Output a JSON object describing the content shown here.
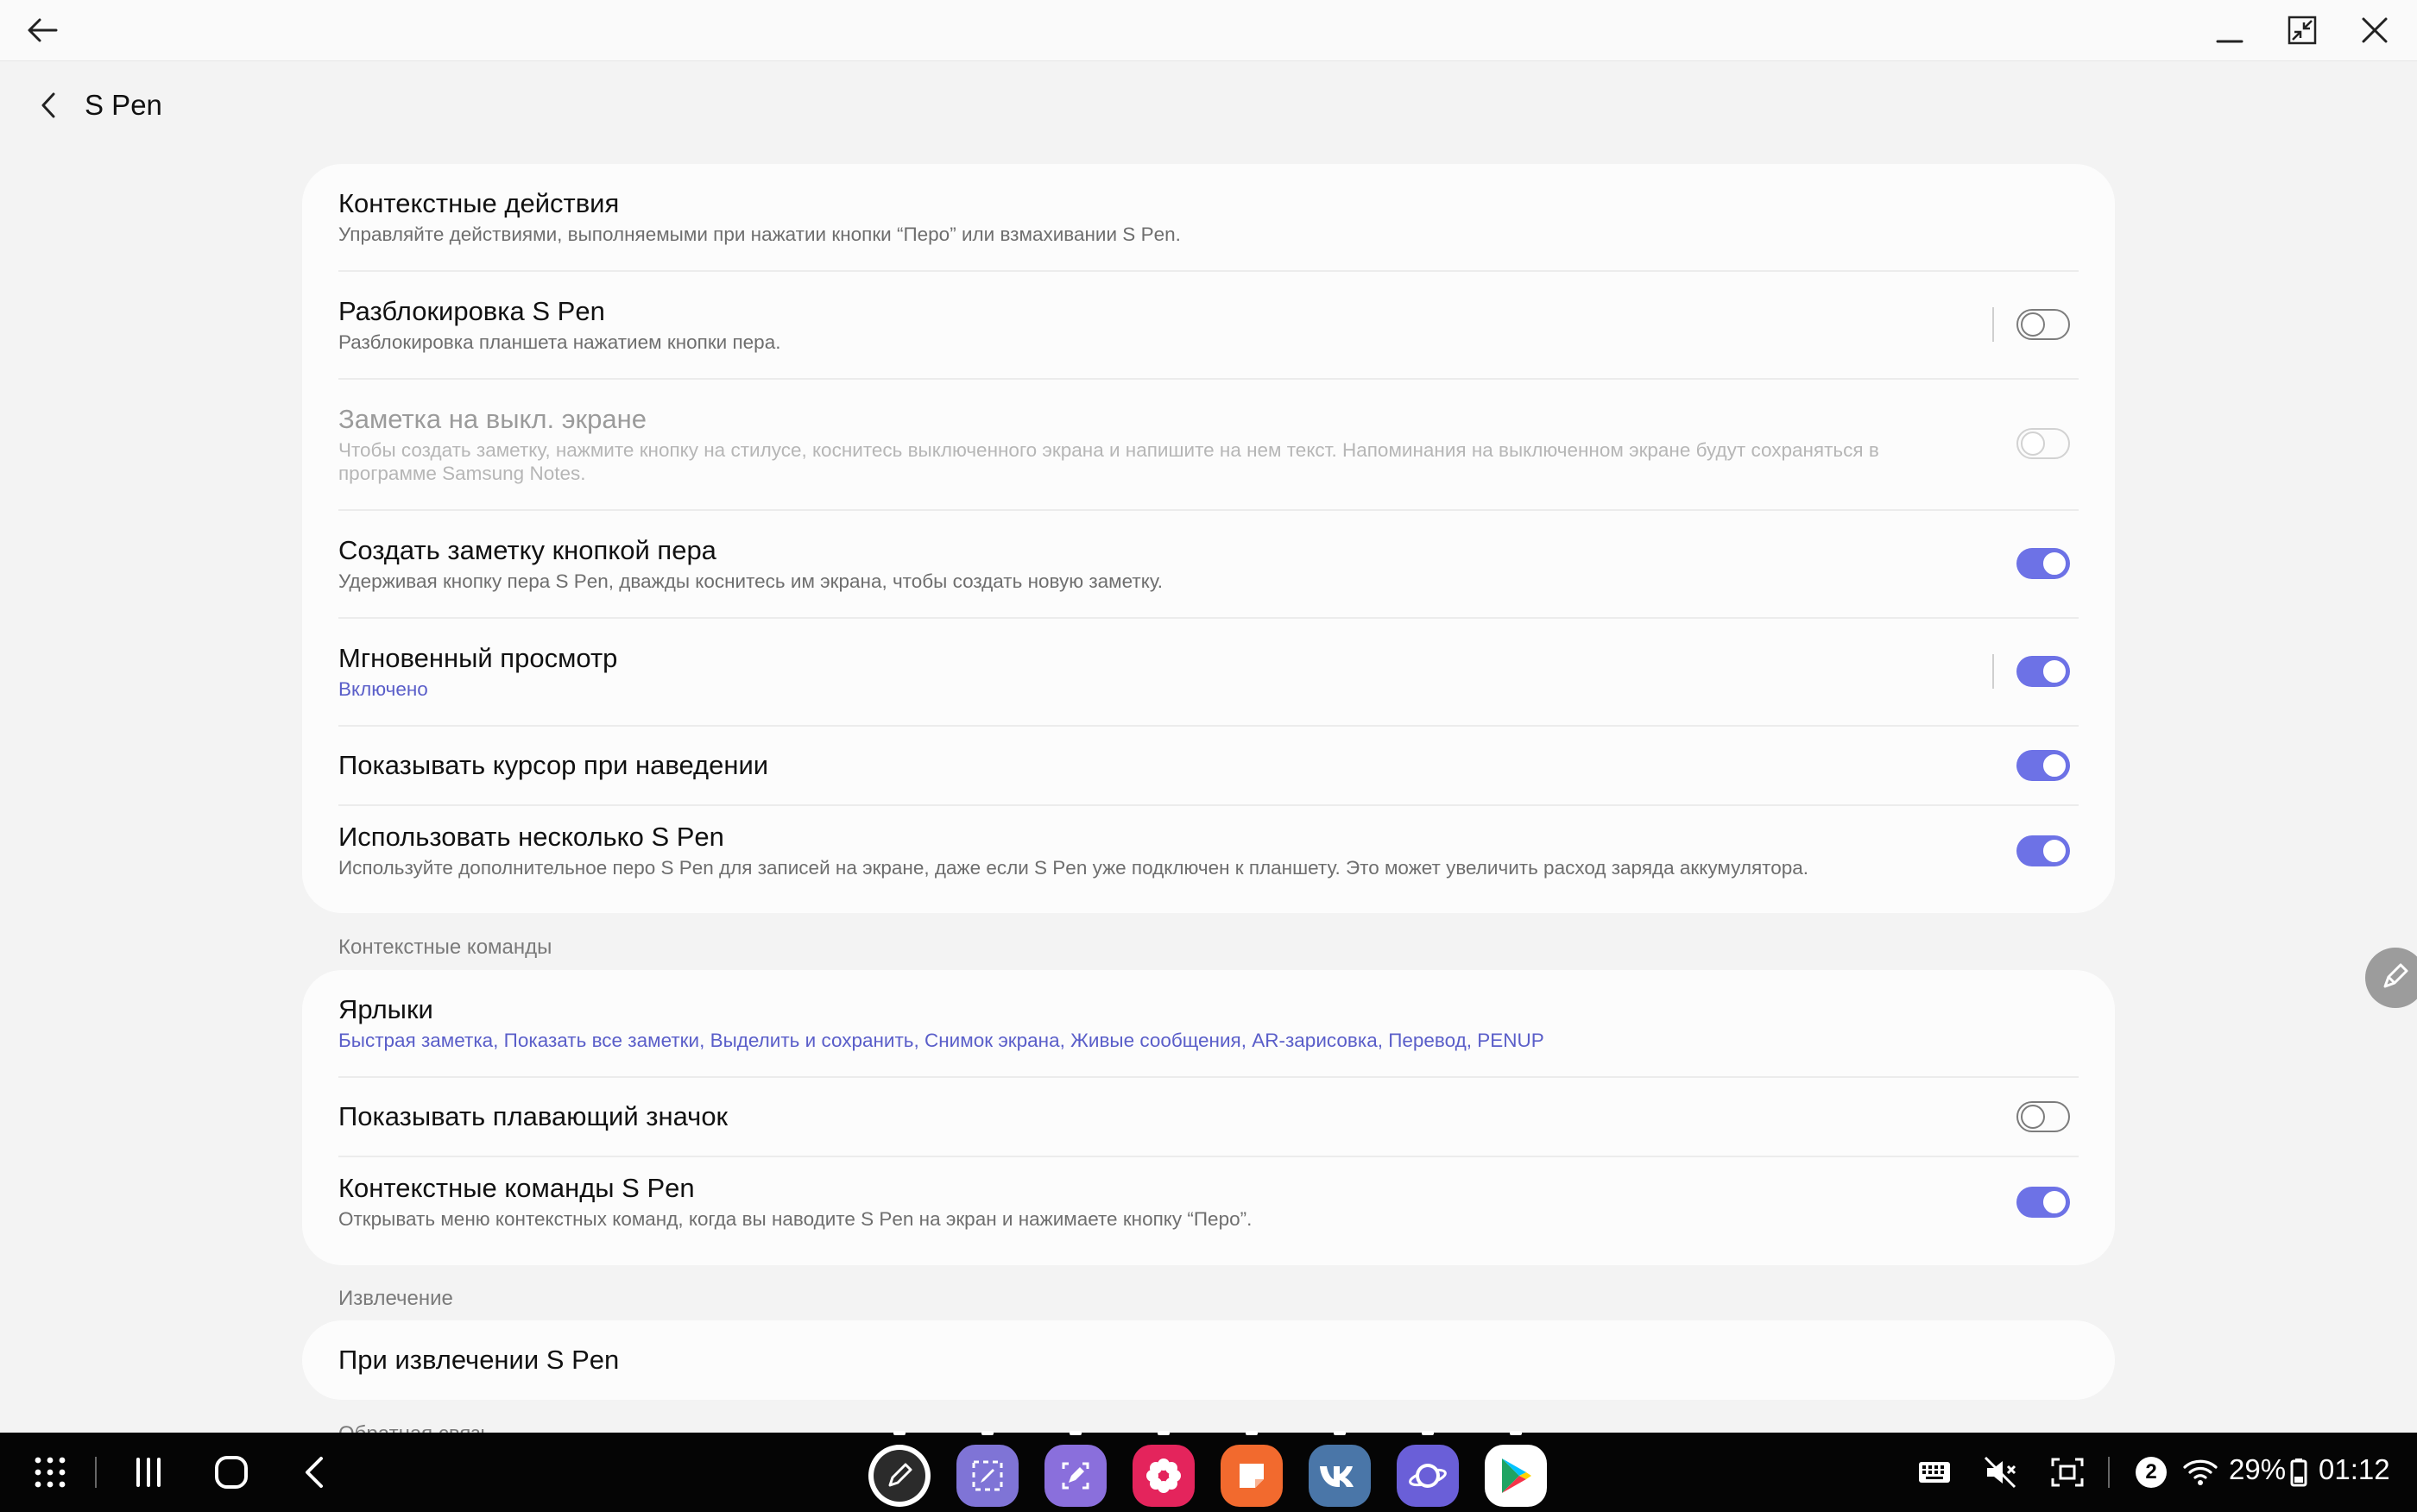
{
  "window": {
    "back_icon": "arrow-left-icon",
    "minimize_icon": "minimize-icon",
    "restore_icon": "restore-window-icon",
    "close_icon": "close-icon"
  },
  "header": {
    "title": "S Pen",
    "back_icon": "chevron-left-icon"
  },
  "settings": [
    {
      "title": "Контекстные действия",
      "subtitle": "Управляйте действиями, выполняемыми при нажатии кнопки “Перо” или взмахивании S Pen."
    },
    {
      "title": "Разблокировка S Pen",
      "subtitle": "Разблокировка планшета нажатием кнопки пера.",
      "toggle": false
    },
    {
      "title": "Заметка на выкл. экране",
      "subtitle": "Чтобы создать заметку, нажмите кнопку на стилусе, коснитесь выключенного экрана и напишите на нем текст. Напоминания на выключенном экране будут сохраняться в программе Samsung Notes.",
      "toggle": false,
      "disabled": true
    },
    {
      "title": "Создать заметку кнопкой пера",
      "subtitle": "Удерживая кнопку пера S Pen, дважды коснитесь им экрана, чтобы создать новую заметку.",
      "toggle": true
    },
    {
      "title": "Мгновенный просмотр",
      "subtitle": "Включено",
      "toggle": true
    },
    {
      "title": "Показывать курсор при наведении",
      "toggle": true
    },
    {
      "title": "Использовать несколько S Pen",
      "subtitle": "Используйте дополнительное перо S Pen для записей на экране, даже если S Pen уже подключен к планшету. Это может увеличить расход заряда аккумулятора.",
      "toggle": true
    }
  ],
  "air_command": {
    "section_label": "Контекстные команды",
    "items": [
      {
        "title": "Ярлыки",
        "subtitle": "Быстрая заметка, Показать все заметки, Выделить и сохранить, Снимок экрана, Живые сообщения, AR-зарисовка, Перевод, PENUP"
      },
      {
        "title": "Показывать плавающий значок",
        "toggle": false
      },
      {
        "title": "Контекстные команды S Pen",
        "subtitle": "Открывать меню контекстных команд, когда вы наводите S Pen на экран и нажимаете кнопку “Перо”.",
        "toggle": true
      }
    ]
  },
  "removal": {
    "section_label": "Извлечение",
    "items": [
      {
        "title": "При извлечении S Pen"
      }
    ],
    "next_section_partial": "Обратная связь"
  },
  "floating_button": {
    "icon": "pen-icon"
  },
  "taskbar": {
    "apps_icon": "app-drawer-icon",
    "recents_icon": "recent-apps-icon",
    "home_icon": "home-icon",
    "back_icon": "back-icon",
    "apps": [
      {
        "name": "pen-app-icon",
        "color": "#ffffff"
      },
      {
        "name": "screen-write-icon",
        "color": "#7f74d6"
      },
      {
        "name": "ar-doodle-icon",
        "color": "#8a6fdc"
      },
      {
        "name": "flower-app-icon",
        "color": "#e4245c"
      },
      {
        "name": "notes-app-icon",
        "color": "#f26a2e"
      },
      {
        "name": "vk-app-icon",
        "color": "#4a76a8"
      },
      {
        "name": "browser-app-icon",
        "color": "#6a5fd8"
      },
      {
        "name": "play-store-icon",
        "color": "#ffffff"
      }
    ],
    "status": {
      "keyboard_icon": "keyboard-icon",
      "mute_icon": "mute-icon",
      "capture_icon": "screen-capture-icon",
      "notification_count": "2",
      "wifi_icon": "wifi-icon",
      "battery": "29%",
      "battery_icon": "battery-icon",
      "time": "01:12"
    }
  }
}
